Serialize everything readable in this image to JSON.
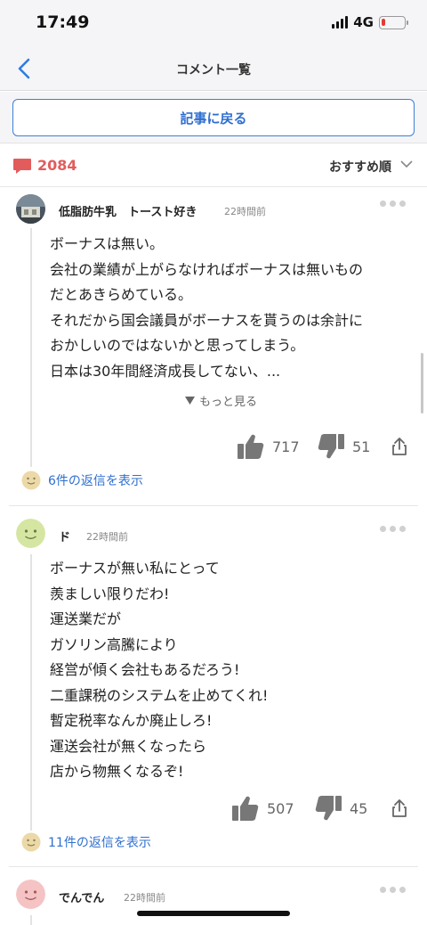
{
  "status_bar": {
    "time": "17:49",
    "network": "4G",
    "battery_level": 0.15
  },
  "nav": {
    "title": "コメント一覧",
    "back_icon": "chevron-left-icon"
  },
  "return_button": {
    "label": "記事に戻る"
  },
  "comments_header": {
    "count": "2084",
    "sort_label": "おすすめ順",
    "accent": "#e25c5c"
  },
  "comments": [
    {
      "username": "低脂肪牛乳　トースト好き",
      "time": "22時間前",
      "lines": [
        "ボーナスは無い。",
        "会社の業績が上がらなければボーナスは無いもの",
        "だとあきらめている。",
        "それだから国会議員がボーナスを貰うのは余計に",
        "おかしいのではないかと思ってしまう。",
        "日本は30年間経済成長してない、..."
      ],
      "show_more": "もっと見る",
      "likes": "717",
      "dislikes": "51",
      "replies": "6件の返信を表示"
    },
    {
      "username": "ド",
      "time": "22時間前",
      "lines": [
        "ボーナスが無い私にとって",
        "羨ましい限りだわ!",
        "運送業だが",
        "ガソリン高騰により",
        "経営が傾く会社もあるだろう!",
        "二重課税のシステムを止めてくれ!",
        "暫定税率なんか廃止しろ!",
        "運送会社が無くなったら",
        "店から物無くなるぞ!"
      ],
      "likes": "507",
      "dislikes": "45",
      "replies": "11件の返信を表示"
    },
    {
      "username": "でんでん",
      "time": "22時間前"
    }
  ]
}
